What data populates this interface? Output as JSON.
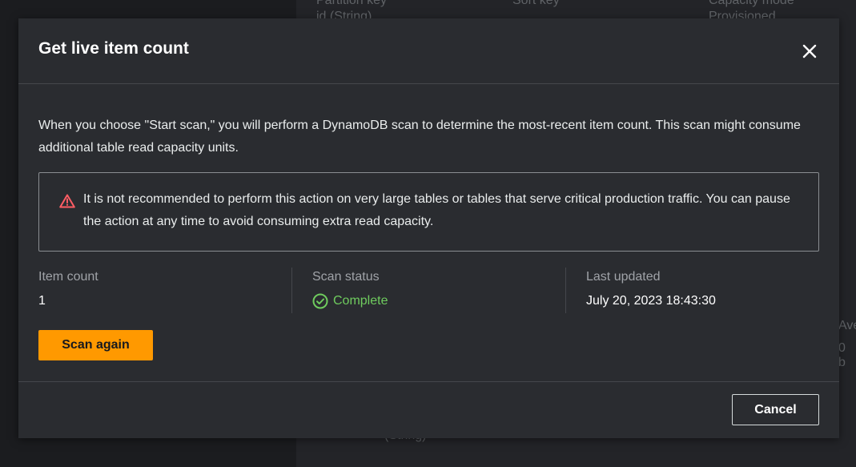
{
  "background": {
    "partial_texts": [
      "Partition key",
      "id (String)",
      "Sort key",
      "Capacity mode",
      "Provisioned",
      "Ave",
      "0 b",
      "(String)"
    ]
  },
  "modal": {
    "title": "Get live item count",
    "close_icon": "close-icon",
    "description": "When you choose \"Start scan,\" you will perform a DynamoDB scan to determine the most-recent item count. This scan might consume additional table read capacity units.",
    "alert": {
      "icon": "warning-triangle-icon",
      "text": "It is not recommended to perform this action on very large tables or tables that serve critical production traffic. You can pause the action at any time to avoid consuming extra read capacity."
    },
    "item_count": {
      "label": "Item count",
      "value": "1"
    },
    "scan_status": {
      "label": "Scan status",
      "value": "Complete",
      "icon": "check-circle-icon"
    },
    "last_updated": {
      "label": "Last updated",
      "value": "July 20, 2023 18:43:30"
    },
    "scan_again_label": "Scan again",
    "cancel_label": "Cancel"
  },
  "colors": {
    "primary_button": "#ff9900",
    "success": "#6fcc5e",
    "warning": "#ff5d64",
    "modal_bg": "#2a2c30"
  }
}
